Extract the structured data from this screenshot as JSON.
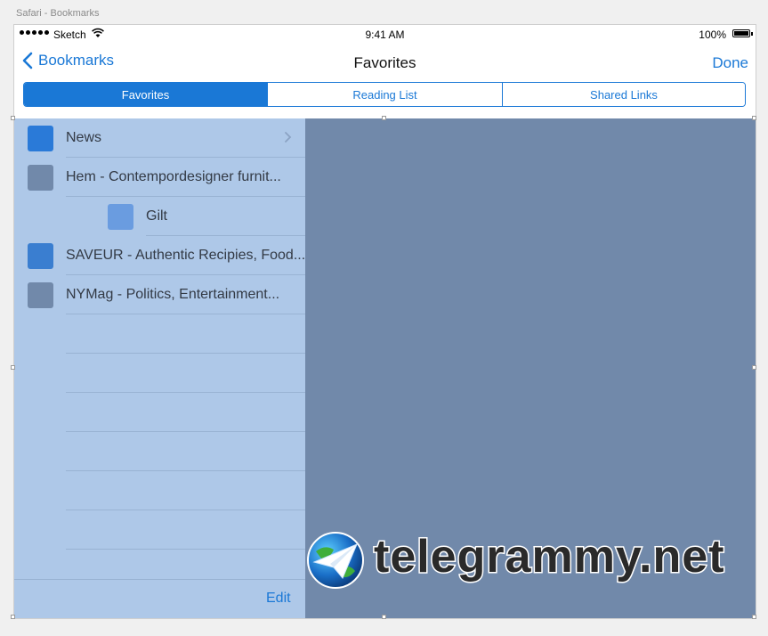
{
  "canvas": {
    "label": "Safari - Bookmarks"
  },
  "status_bar": {
    "carrier": "Sketch",
    "time": "9:41 AM",
    "battery": "100%"
  },
  "nav_bar": {
    "back_label": "Bookmarks",
    "title": "Favorites",
    "done_label": "Done"
  },
  "segments": [
    {
      "label": "Favorites",
      "active": true
    },
    {
      "label": "Reading List",
      "active": false
    },
    {
      "label": "Shared Links",
      "active": false
    }
  ],
  "bookmarks": [
    {
      "label": "News",
      "icon": "folder-icon",
      "color": "#2a7ad8"
    },
    {
      "label": "Hem - Contempordesigner furnit...",
      "icon": "bookmark-icon",
      "color": "#7189aa"
    },
    {
      "label": "Gilt",
      "icon": "bookmark-icon",
      "color": "#6a9ce0"
    },
    {
      "label": "SAVEUR - Authentic Recipies, Food...",
      "icon": "bookmark-icon",
      "color": "#3a7ed0"
    },
    {
      "label": "NYMag - Politics, Entertainment...",
      "icon": "bookmark-icon",
      "color": "#7189aa"
    }
  ],
  "footer": {
    "edit_label": "Edit"
  },
  "watermark": {
    "text": "telegrammy.net"
  },
  "colors": {
    "accent": "#1a78d6",
    "left_pane": "#aec8e8",
    "right_pane": "#7189aa"
  }
}
